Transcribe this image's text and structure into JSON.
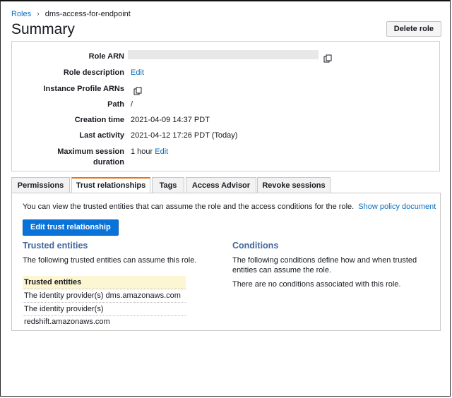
{
  "breadcrumb": {
    "parent": "Roles",
    "separator": "›",
    "current": "dms-access-for-endpoint"
  },
  "page": {
    "title": "Summary",
    "delete_label": "Delete role"
  },
  "summary": {
    "role_arn_label": "Role ARN",
    "role_description_label": "Role description",
    "role_description_edit": "Edit",
    "instance_profile_label": "Instance Profile ARNs",
    "path_label": "Path",
    "path_value": "/",
    "creation_time_label": "Creation time",
    "creation_time_value": "2021-04-09 14:37 PDT",
    "last_activity_label": "Last activity",
    "last_activity_value": "2021-04-12 17:26 PDT (Today)",
    "max_session_label_1": "Maximum session",
    "max_session_label_2": "duration",
    "max_session_value": "1 hour",
    "max_session_edit": "Edit"
  },
  "tabs": [
    "Permissions",
    "Trust relationships",
    "Tags",
    "Access Advisor",
    "Revoke sessions"
  ],
  "active_tab": "Trust relationships",
  "trust": {
    "intro": "You can view the trusted entities that can assume the role and the access conditions for the role.",
    "show_policy": "Show policy document",
    "edit_button": "Edit trust relationship",
    "entities_title": "Trusted entities",
    "entities_desc": "The following trusted entities can assume this role.",
    "table_header": "Trusted entities",
    "entities": [
      "The identity provider(s) dms.amazonaws.com",
      "The identity provider(s) redshift.amazonaws.com"
    ],
    "conditions_title": "Conditions",
    "conditions_desc": "The following conditions define how and when trusted entities can assume the role.",
    "conditions_none": "There are no conditions associated with this role."
  },
  "colors": {
    "link": "#0a6ebd",
    "primary": "#0a73d9",
    "active_tab_accent": "#ec7211",
    "section_title": "#44679a"
  }
}
